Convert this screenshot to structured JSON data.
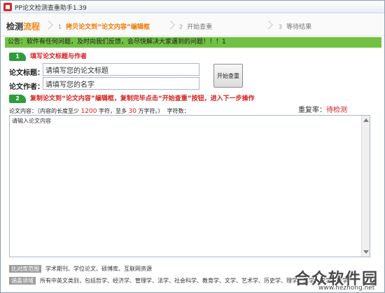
{
  "window": {
    "title": "PP论文检测查重助手1.39"
  },
  "steps": {
    "title_part1": "检测",
    "title_part2": "流程",
    "items": [
      {
        "num": "1",
        "label": "拷贝论文到“论文内容”编辑框"
      },
      {
        "num": "2",
        "label": "开始查重"
      },
      {
        "num": "3",
        "label": "等待结果"
      }
    ]
  },
  "notice": "公告：软件有任何问题，及时向我们反馈，会尽快解决大家遇到的问题！！！1",
  "section1": {
    "badge": "1",
    "title": "填写论文标题与作者"
  },
  "form": {
    "title_label": "论文标题：",
    "title_value": "请填写您的论文标题",
    "author_label": "论文作者：",
    "author_value": "请填写您的名字",
    "start_label": "开始查重"
  },
  "section2": {
    "badge": "2",
    "title": "复制论文到“论文内容”编辑框，复制完毕点击“开始查重”按钮，进入下一步操作"
  },
  "content": {
    "label_prefix": "论文内容：（内容的长度至少",
    "min": "1200",
    "mid": "字符，至多",
    "max": "30",
    "label_suffix": "万字符。）",
    "count_label": "字符数：",
    "dup_label": "重复率：",
    "dup_value": "待检测",
    "placeholder": "请输入论文内容"
  },
  "footer": {
    "compare_tag": "比对库范围",
    "compare_text": "学术期刊、学位论文、硕博库、互联网资源",
    "cover_tag": "涵盖领域",
    "cover_text": "所有中英文类别，包括哲学、经济学、管理学、法学、社会科学、教育学、文学、艺术学、历史学、理学、工学、农学、医学"
  },
  "watermark": {
    "logo": "合众软件园",
    "url": "www.hezhong.net"
  },
  "colors": {
    "accent": "#ef8a1a",
    "notice_bg": "#71c243",
    "red": "#d81e1e",
    "badge_green": "#2f9d3a"
  }
}
